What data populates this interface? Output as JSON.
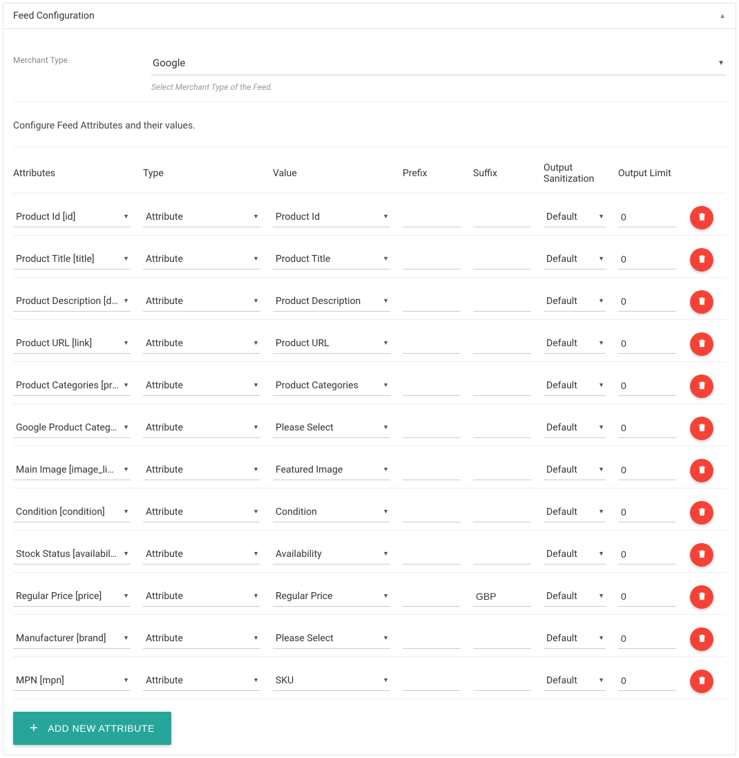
{
  "panel": {
    "title": "Feed Configuration"
  },
  "merchant": {
    "label": "Merchant Type",
    "value": "Google",
    "hint": "Select Merchant Type of the Feed."
  },
  "config_desc": "Configure Feed Attributes and their values.",
  "columns": {
    "attributes": "Attributes",
    "type": "Type",
    "value": "Value",
    "prefix": "Prefix",
    "suffix": "Suffix",
    "sanitization": "Output Sanitization",
    "limit": "Output Limit"
  },
  "rows": [
    {
      "attribute": "Product Id [id]",
      "type": "Attribute",
      "value": "Product Id",
      "prefix": "",
      "suffix": "",
      "sanitization": "Default",
      "limit": "0"
    },
    {
      "attribute": "Product Title [title]",
      "type": "Attribute",
      "value": "Product Title",
      "prefix": "",
      "suffix": "",
      "sanitization": "Default",
      "limit": "0"
    },
    {
      "attribute": "Product Description [description]",
      "type": "Attribute",
      "value": "Product Description",
      "prefix": "",
      "suffix": "",
      "sanitization": "Default",
      "limit": "0"
    },
    {
      "attribute": "Product URL [link]",
      "type": "Attribute",
      "value": "Product URL",
      "prefix": "",
      "suffix": "",
      "sanitization": "Default",
      "limit": "0"
    },
    {
      "attribute": "Product Categories [product_type]",
      "type": "Attribute",
      "value": "Product Categories",
      "prefix": "",
      "suffix": "",
      "sanitization": "Default",
      "limit": "0"
    },
    {
      "attribute": "Google Product Category [google_product_category]",
      "type": "Attribute",
      "value": "Please Select",
      "prefix": "",
      "suffix": "",
      "sanitization": "Default",
      "limit": "0"
    },
    {
      "attribute": "Main Image [image_link]",
      "type": "Attribute",
      "value": "Featured Image",
      "prefix": "",
      "suffix": "",
      "sanitization": "Default",
      "limit": "0"
    },
    {
      "attribute": "Condition [condition]",
      "type": "Attribute",
      "value": "Condition",
      "prefix": "",
      "suffix": "",
      "sanitization": "Default",
      "limit": "0"
    },
    {
      "attribute": "Stock Status [availability]",
      "type": "Attribute",
      "value": "Availability",
      "prefix": "",
      "suffix": "",
      "sanitization": "Default",
      "limit": "0"
    },
    {
      "attribute": "Regular Price [price]",
      "type": "Attribute",
      "value": "Regular Price",
      "prefix": "",
      "suffix": "GBP",
      "sanitization": "Default",
      "limit": "0"
    },
    {
      "attribute": "Manufacturer [brand]",
      "type": "Attribute",
      "value": "Please Select",
      "prefix": "",
      "suffix": "",
      "sanitization": "Default",
      "limit": "0"
    },
    {
      "attribute": "MPN [mpn]",
      "type": "Attribute",
      "value": "SKU",
      "prefix": "",
      "suffix": "",
      "sanitization": "Default",
      "limit": "0"
    }
  ],
  "attribute_display": [
    "Product Id [id]",
    "Product Title [title]",
    "Product Description [de…",
    "Product URL [link]",
    "Product Categories [pro…",
    "Google Product Categor…",
    "Main Image [image_link]",
    "Condition [condition]",
    "Stock Status [availability]",
    "Regular Price [price]",
    "Manufacturer [brand]",
    "MPN [mpn]"
  ],
  "buttons": {
    "add": "ADD NEW ATTRIBUTE"
  }
}
